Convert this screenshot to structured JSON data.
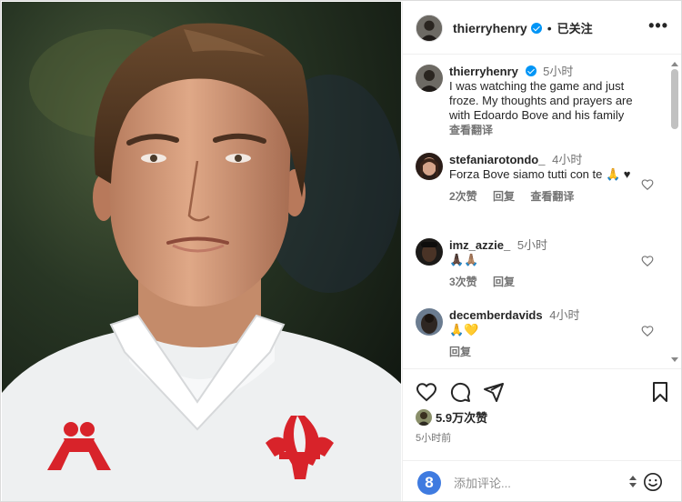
{
  "post": {
    "author": "thierryhenry",
    "follow_label": "已关注",
    "more_label": "•••",
    "caption": {
      "username": "thierryhenry",
      "time": "5小时",
      "text": "I was watching the game and just froze. My thoughts and prayers are with Edoardo Bove and his family",
      "translate": "查看翻译"
    }
  },
  "comments": [
    {
      "username": "stefaniarotondo_",
      "time": "4小时",
      "text": "Forza Bove siamo tutti con te 🙏 ♥",
      "likes": "2次赞",
      "reply": "回复",
      "translate": "查看翻译"
    },
    {
      "username": "imz_azzie_",
      "time": "5小时",
      "text": "🙏🏿🙏🏽",
      "likes": "3次赞",
      "reply": "回复"
    },
    {
      "username": "decemberdavids",
      "time": "4小时",
      "text": "🙏💛",
      "reply": "回复"
    }
  ],
  "footer": {
    "likes_count": "5.9万次赞",
    "posted_time": "5小时前",
    "comment_placeholder": "添加评论...",
    "emoji_button_label": "8"
  },
  "icons": {
    "like": "heart-icon",
    "comment": "comment-icon",
    "share": "share-icon",
    "save": "bookmark-icon",
    "emoji": "smiley-icon",
    "verified": "verified-badge-icon"
  },
  "colors": {
    "verified_blue": "#0095f6",
    "secondary_text": "#737373",
    "jersey_red": "#d8232a"
  }
}
